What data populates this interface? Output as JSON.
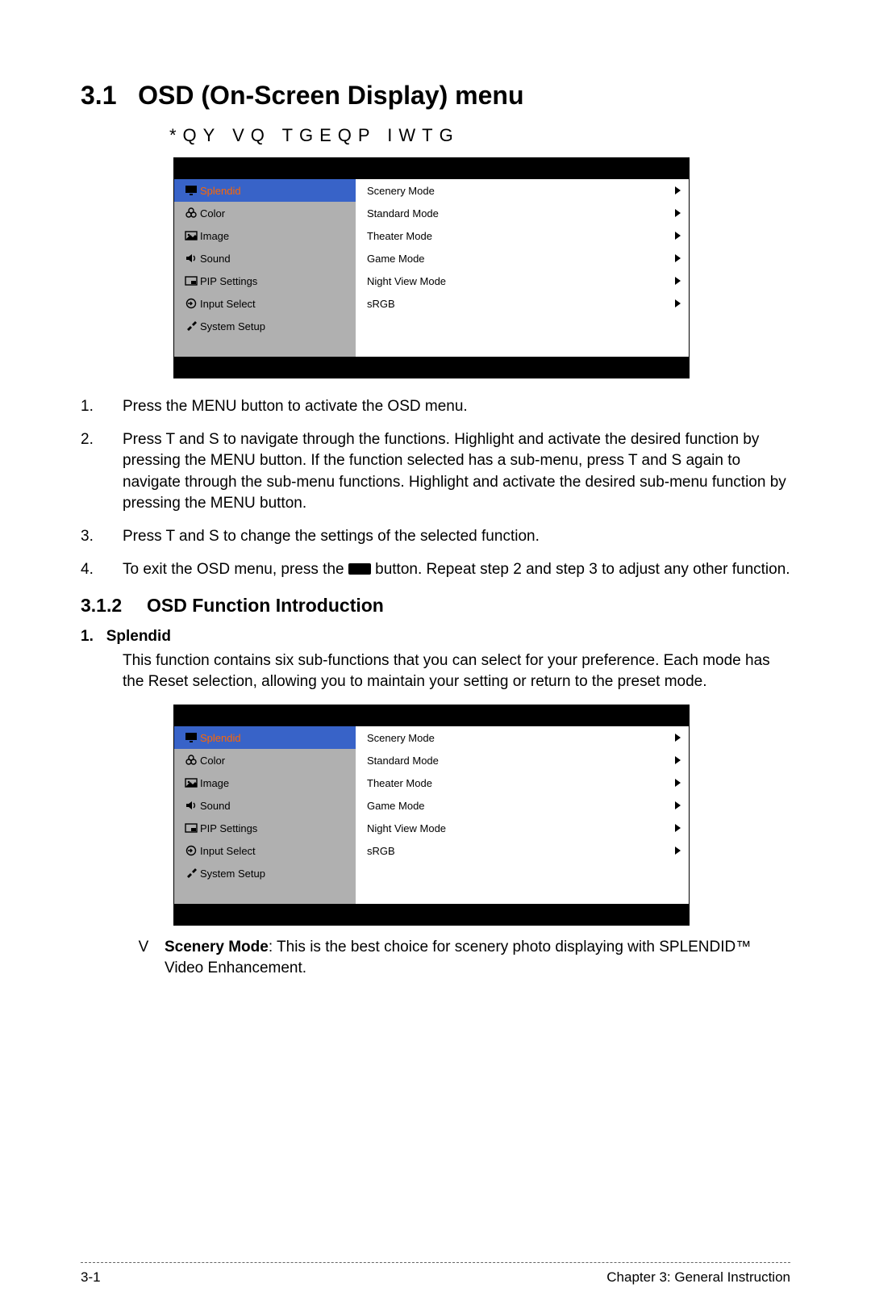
{
  "heading": {
    "number": "3.1",
    "title": "OSD (On-Screen Display) menu",
    "sub": "*QY VQ TGEQP IWTG"
  },
  "osd": {
    "left_items": [
      {
        "label": "Splendid",
        "icon": "monitor",
        "selected": true
      },
      {
        "label": "Color",
        "icon": "rgb",
        "selected": false
      },
      {
        "label": "Image",
        "icon": "image",
        "selected": false
      },
      {
        "label": "Sound",
        "icon": "sound",
        "selected": false
      },
      {
        "label": "PIP Settings",
        "icon": "pip",
        "selected": false
      },
      {
        "label": "Input Select",
        "icon": "input",
        "selected": false
      },
      {
        "label": "System Setup",
        "icon": "tools",
        "selected": false
      }
    ],
    "right_items": [
      {
        "label": "Scenery Mode"
      },
      {
        "label": "Standard Mode"
      },
      {
        "label": "Theater Mode"
      },
      {
        "label": "Game Mode"
      },
      {
        "label": "Night View Mode"
      },
      {
        "label": "sRGB"
      }
    ]
  },
  "steps": {
    "s1": "Press the MENU button to activate the OSD menu.",
    "s2": "Press  T  and  S  to navigate through the functions. Highlight and activate the desired function by pressing the MENU button. If the function selected has a sub-menu, press  T  and  S  again to navigate through the sub-menu functions. Highlight and activate the desired sub-menu function by pressing the MENU button.",
    "s3": "Press  T  and  S  to change the settings of the selected function.",
    "s4a": "To exit the OSD menu, press the ",
    "s4b": " button. Repeat step 2 and step 3 to adjust any other function."
  },
  "section312": {
    "number": "3.1.2",
    "title": "OSD Function Introduction",
    "splendid_num": "1.",
    "splendid_title": "Splendid",
    "splendid_body": "This function contains six sub-functions that you can select for your preference. Each mode has the Reset selection, allowing you to maintain your setting or return to the preset mode."
  },
  "scenery": {
    "bullet": "V",
    "label": "Scenery Mode",
    "body": ": This is the best choice for scenery photo displaying with SPLENDID™ Video Enhancement."
  },
  "footer": {
    "left": "3-1",
    "right": "Chapter 3: General Instruction"
  },
  "labels": {
    "n1": "1.",
    "n2": "2.",
    "n3": "3.",
    "n4": "4."
  }
}
